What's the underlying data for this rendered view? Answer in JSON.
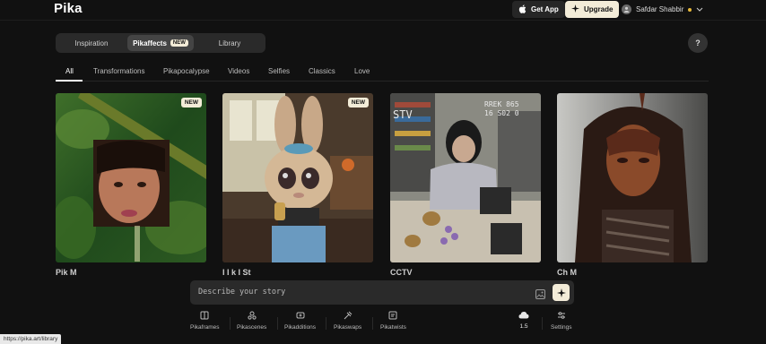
{
  "header": {
    "logo": "Pika",
    "get_app": "Get App",
    "upgrade": "Upgrade",
    "user_name": "Safdar Shabbir"
  },
  "tabs": [
    {
      "label": "Inspiration",
      "active": false
    },
    {
      "label": "Pikaffects",
      "active": true,
      "badge": "NEW"
    },
    {
      "label": "Library",
      "active": false
    }
  ],
  "help_label": "?",
  "categories": [
    "All",
    "Transformations",
    "Pikapocalypse",
    "Videos",
    "Selfies",
    "Classics",
    "Love"
  ],
  "active_category": "All",
  "cards": [
    {
      "title": "Pik M",
      "badge": "NEW"
    },
    {
      "title": "I I k I  St",
      "badge": "NEW"
    },
    {
      "title": "CCTV",
      "badge": ""
    },
    {
      "title": "Ch  M",
      "badge": ""
    }
  ],
  "card_overlay_text": {
    "stv": "STV",
    "rec": "REC",
    "time": "RREK 865\n16 S02 0"
  },
  "prompt": {
    "placeholder": "Describe your story"
  },
  "toolbar": [
    {
      "label": "Pikaframes",
      "icon": "frames-icon"
    },
    {
      "label": "Pikascenes",
      "icon": "scenes-icon"
    },
    {
      "label": "Pikadditions",
      "icon": "additions-icon"
    },
    {
      "label": "Pikaswaps",
      "icon": "swaps-icon"
    },
    {
      "label": "Pikatwists",
      "icon": "twists-icon"
    }
  ],
  "model": {
    "label": "1.5"
  },
  "settings_label": "Settings",
  "status_url": "https://pika.art/library",
  "colors": {
    "background": "#111111",
    "accent": "#f3ecd8",
    "surface": "#2a2a2a"
  }
}
